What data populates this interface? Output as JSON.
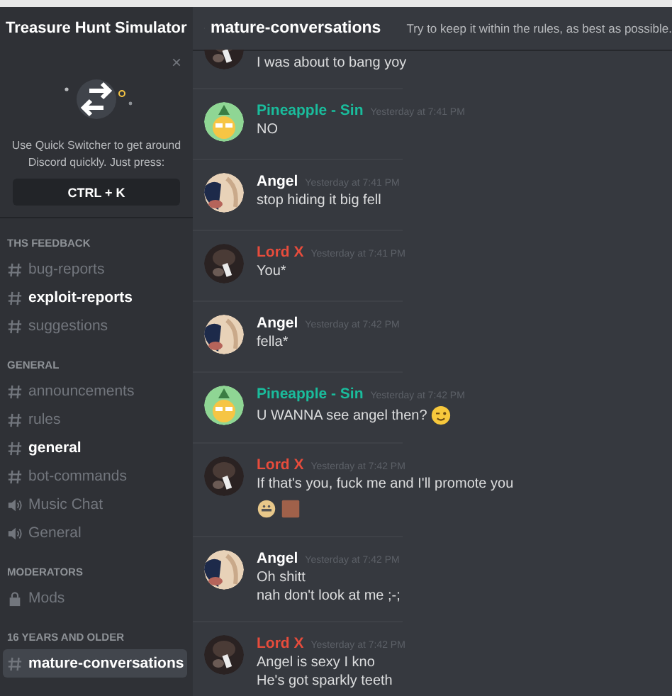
{
  "server": {
    "name": "Treasure Hunt Simulator"
  },
  "quick_switcher": {
    "text": "Use Quick Switcher to get around Discord quickly. Just press:",
    "shortcut": "CTRL + K",
    "close": "×"
  },
  "categories": [
    {
      "name": "THS FEEDBACK",
      "channels": [
        {
          "kind": "text",
          "name": "bug-reports",
          "unread": false,
          "selected": false
        },
        {
          "kind": "text",
          "name": "exploit-reports",
          "unread": true,
          "selected": false
        },
        {
          "kind": "text",
          "name": "suggestions",
          "unread": false,
          "selected": false
        }
      ]
    },
    {
      "name": "GENERAL",
      "channels": [
        {
          "kind": "text",
          "name": "announcements",
          "unread": false,
          "selected": false
        },
        {
          "kind": "text",
          "name": "rules",
          "unread": false,
          "selected": false
        },
        {
          "kind": "text",
          "name": "general",
          "unread": true,
          "selected": false
        },
        {
          "kind": "text",
          "name": "bot-commands",
          "unread": false,
          "selected": false
        },
        {
          "kind": "voice",
          "name": "Music Chat",
          "unread": false,
          "selected": false
        },
        {
          "kind": "voice",
          "name": "General",
          "unread": false,
          "selected": false
        }
      ]
    },
    {
      "name": "MODERATORS",
      "channels": [
        {
          "kind": "locked",
          "name": "Mods",
          "unread": false,
          "selected": false
        }
      ]
    },
    {
      "name": "16 YEARS AND OLDER",
      "channels": [
        {
          "kind": "nsfw",
          "name": "mature-conversations",
          "unread": true,
          "selected": true
        }
      ]
    }
  ],
  "channel_header": {
    "name": "mature-conversations",
    "topic": "Try to keep it within the rules, as best as possible."
  },
  "messages": [
    {
      "avatar": {
        "kind": "dark"
      },
      "lines": [
        "I was about to bang yoy"
      ]
    },
    {
      "avatar": {
        "kind": "pineapple"
      },
      "author": "Pineapple - Sin",
      "color": "#1abc9c",
      "time": "Yesterday at 7:41 PM",
      "lines": [
        "NO"
      ]
    },
    {
      "avatar": {
        "kind": "light"
      },
      "author": "Angel",
      "color": "#ffffff",
      "time": "Yesterday at 7:41 PM",
      "lines": [
        "stop  hiding it big fell"
      ]
    },
    {
      "avatar": {
        "kind": "dark"
      },
      "author": "Lord X",
      "color": "#e74c3c",
      "time": "Yesterday at 7:41 PM",
      "lines": [
        "You*"
      ]
    },
    {
      "avatar": {
        "kind": "light"
      },
      "author": "Angel",
      "color": "#ffffff",
      "time": "Yesterday at 7:42 PM",
      "lines": [
        "fella*"
      ]
    },
    {
      "avatar": {
        "kind": "pineapple"
      },
      "author": "Pineapple - Sin",
      "color": "#1abc9c",
      "time": "Yesterday at 7:42 PM",
      "lines": [
        "U WANNA see angel then?"
      ],
      "trailing_emoji": {
        "kind": "wink"
      }
    },
    {
      "avatar": {
        "kind": "dark"
      },
      "author": "Lord X",
      "color": "#e74c3c",
      "time": "Yesterday at 7:42 PM",
      "lines": [
        "If that's you, fuck me and I'll promote you"
      ],
      "emoji_row": [
        {
          "kind": "face"
        },
        {
          "kind": "square"
        }
      ]
    },
    {
      "avatar": {
        "kind": "light"
      },
      "author": "Angel",
      "color": "#ffffff",
      "time": "Yesterday at 7:42 PM",
      "lines": [
        "Oh shitt",
        "nah don't look at me ;-;"
      ]
    },
    {
      "avatar": {
        "kind": "dark"
      },
      "author": "Lord X",
      "color": "#e74c3c",
      "time": "Yesterday at 7:42 PM",
      "lines": [
        "Angel is sexy I kno",
        "He's got sparkly teeth"
      ]
    }
  ]
}
